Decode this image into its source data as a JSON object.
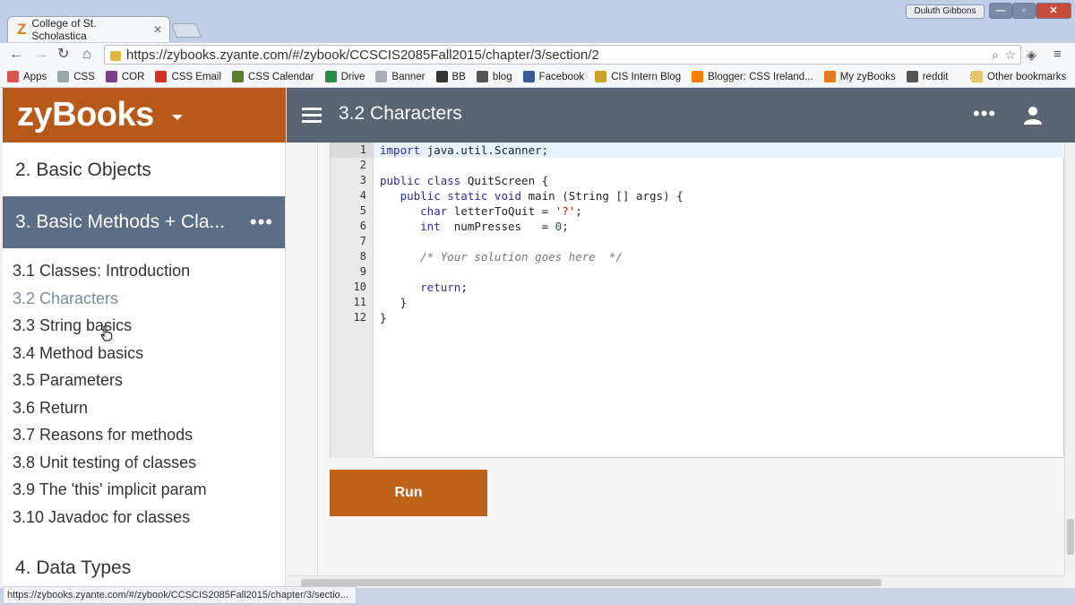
{
  "browser": {
    "tab_title": "College of St. Scholastica",
    "user_name": "Duluth Gibbons",
    "url": "https://zybooks.zyante.com/#/zybook/CCSCIS2085Fall2015/chapter/3/section/2",
    "status_url": "https://zybooks.zyante.com/#/zybook/CCSCIS2085Fall2015/chapter/3/sectio...",
    "bookmarks": [
      {
        "label": "Apps",
        "icon": "apps-grid-icon",
        "color": "#d9534f"
      },
      {
        "label": "CSS",
        "icon": "page-icon",
        "color": "#9aa"
      },
      {
        "label": "COR",
        "icon": "cor-icon",
        "color": "#7a3f8f"
      },
      {
        "label": "CSS Email",
        "icon": "gmail-icon",
        "color": "#d93025"
      },
      {
        "label": "CSS Calendar",
        "icon": "shield-icon",
        "color": "#5b7f2a"
      },
      {
        "label": "Drive",
        "icon": "drive-icon",
        "color": "#2a8a4a"
      },
      {
        "label": "Banner",
        "icon": "page-icon",
        "color": "#aab"
      },
      {
        "label": "BB",
        "icon": "bb-icon",
        "color": "#333"
      },
      {
        "label": "blog",
        "icon": "blog-icon",
        "color": "#555"
      },
      {
        "label": "Facebook",
        "icon": "facebook-icon",
        "color": "#3b5998"
      },
      {
        "label": "CIS Intern Blog",
        "icon": "page-icon",
        "color": "#c9a227"
      },
      {
        "label": "Blogger: CSS Ireland...",
        "icon": "blogger-icon",
        "color": "#f57d00"
      },
      {
        "label": "My zyBooks",
        "icon": "zybooks-icon",
        "color": "#e07a1c"
      },
      {
        "label": "reddit",
        "icon": "reddit-icon",
        "color": "#555"
      }
    ],
    "overflow_label": "»",
    "other_bookmarks": "Other bookmarks"
  },
  "app": {
    "logo": "zyBooks",
    "section_title": "3.2 Characters"
  },
  "sidebar": {
    "chapter_prev": "2.  Basic Objects",
    "chapter_active": "3.  Basic Methods + Cla...",
    "chapter_next": "4.  Data Types",
    "sections": [
      "3.1 Classes: Introduction",
      "3.2 Characters",
      "3.3 String basics",
      "3.4 Method basics",
      "3.5 Parameters",
      "3.6 Return",
      "3.7 Reasons for methods",
      "3.8 Unit testing of classes",
      "3.9 The 'this' implicit param",
      "3.10 Javadoc for classes"
    ],
    "current_section_index": 1
  },
  "editor": {
    "line_numbers": [
      "1",
      "2",
      "3",
      "4",
      "5",
      "6",
      "7",
      "8",
      "9",
      "10",
      "11",
      "12"
    ],
    "code": {
      "l1_kw": "import",
      "l1_rest": " java.util.Scanner;",
      "l3_kw": "public class",
      "l3_rest": " QuitScreen {",
      "l4_kw": "   public static void",
      "l4_rest": " main (String [] args) {",
      "l5_kw": "      char",
      "l5_mid": " letterToQuit = ",
      "l5_str": "'?'",
      "l5_end": ";",
      "l6_kw": "      int",
      "l6_mid": "  numPresses   = ",
      "l6_num": "0",
      "l6_end": ";",
      "l8_cmt": "      /* Your solution goes here  */",
      "l10_kw": "      return",
      "l10_end": ";",
      "l11": "   }",
      "l12": "}"
    },
    "run_label": "Run"
  }
}
